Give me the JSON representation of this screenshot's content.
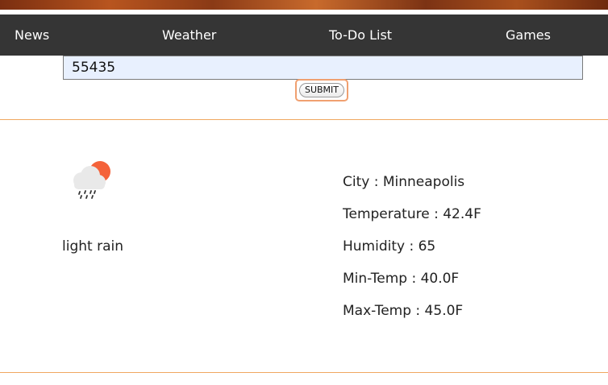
{
  "nav": {
    "items": [
      {
        "label": "News"
      },
      {
        "label": "Weather"
      },
      {
        "label": "To-Do List"
      },
      {
        "label": "Games"
      }
    ]
  },
  "search": {
    "value": "55435",
    "submit_label": "SUBMIT"
  },
  "weather": {
    "icon": "cloud-sun-rain-icon",
    "description": "light rain",
    "city": "City : Minneapolis",
    "temperature": "Temperature : 42.4F",
    "humidity": "Humidity : 65",
    "min_temp": "Min-Temp : 40.0F",
    "max_temp": "Max-Temp : 45.0F"
  },
  "colors": {
    "navbar": "#353535",
    "divider": "#f0a860",
    "sun": "#f4623a",
    "input_bg": "#e8f0fe"
  }
}
